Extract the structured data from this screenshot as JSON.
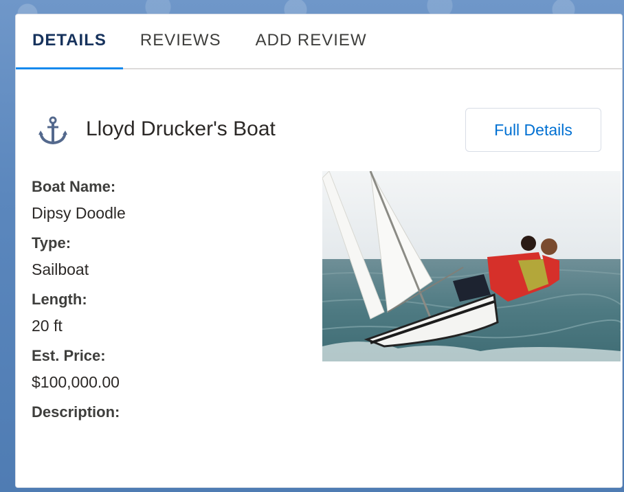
{
  "tabs": {
    "details": "DETAILS",
    "reviews": "REVIEWS",
    "add_review": "ADD REVIEW"
  },
  "boat": {
    "title": "Lloyd Drucker's Boat",
    "full_details_label": "Full Details",
    "fields": [
      {
        "label": "Boat Name:",
        "value": "Dipsy Doodle"
      },
      {
        "label": "Type:",
        "value": "Sailboat"
      },
      {
        "label": "Length:",
        "value": "20 ft"
      },
      {
        "label": "Est. Price:",
        "value": "$100,000.00"
      },
      {
        "label": "Description:",
        "value": ""
      }
    ],
    "photo_icon": "sailboat-photo"
  },
  "icons": {
    "title_icon": "anchor-icon"
  },
  "colors": {
    "accent": "#1589ee",
    "link": "#0070d2",
    "background": "#5b87bd"
  }
}
